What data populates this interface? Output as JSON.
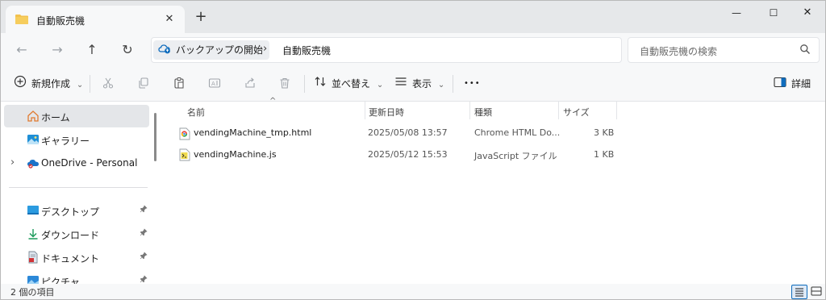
{
  "tab": {
    "title": "自動販売機",
    "close_glyph": "✕",
    "new_glyph": "+"
  },
  "window_controls": {
    "minimize": "—",
    "maximize": "☐",
    "close": "✕"
  },
  "nav": {
    "back": "←",
    "forward": "→",
    "up": "↑",
    "refresh": "↻"
  },
  "address": {
    "crumbs": [
      "バックアップの開始",
      "自動販売機"
    ],
    "separator": "›"
  },
  "search": {
    "placeholder": "自動販売機の検索"
  },
  "toolbar": {
    "new_label": "新規作成",
    "sort_label": "並べ替え",
    "view_label": "表示",
    "more_label": "•••",
    "details_label": "詳細",
    "chevron": "⌄"
  },
  "sidebar": {
    "items": [
      {
        "label": "ホーム"
      },
      {
        "label": "ギャラリー"
      },
      {
        "label": "OneDrive - Personal"
      },
      {
        "label": "デスクトップ"
      },
      {
        "label": "ダウンロード"
      },
      {
        "label": "ドキュメント"
      },
      {
        "label": "ピクチャ"
      }
    ],
    "expand_glyph": "›",
    "pin_glyph": "📌"
  },
  "columns": {
    "name": "名前",
    "modified": "更新日時",
    "type": "種類",
    "size": "サイズ",
    "sort_glyph": "^"
  },
  "files": [
    {
      "name": "vendingMachine_tmp.html",
      "modified": "2025/05/08 13:57",
      "type": "Chrome HTML Do...",
      "size": "3 KB"
    },
    {
      "name": "vendingMachine.js",
      "modified": "2025/05/12 15:53",
      "type": "JavaScript ファイル",
      "size": "1 KB"
    }
  ],
  "status": {
    "count_text": "2 個の項目"
  },
  "colors": {
    "accent": "#0f6cbd",
    "folder": "#f2c14e",
    "selection": "#e4e6e9"
  }
}
